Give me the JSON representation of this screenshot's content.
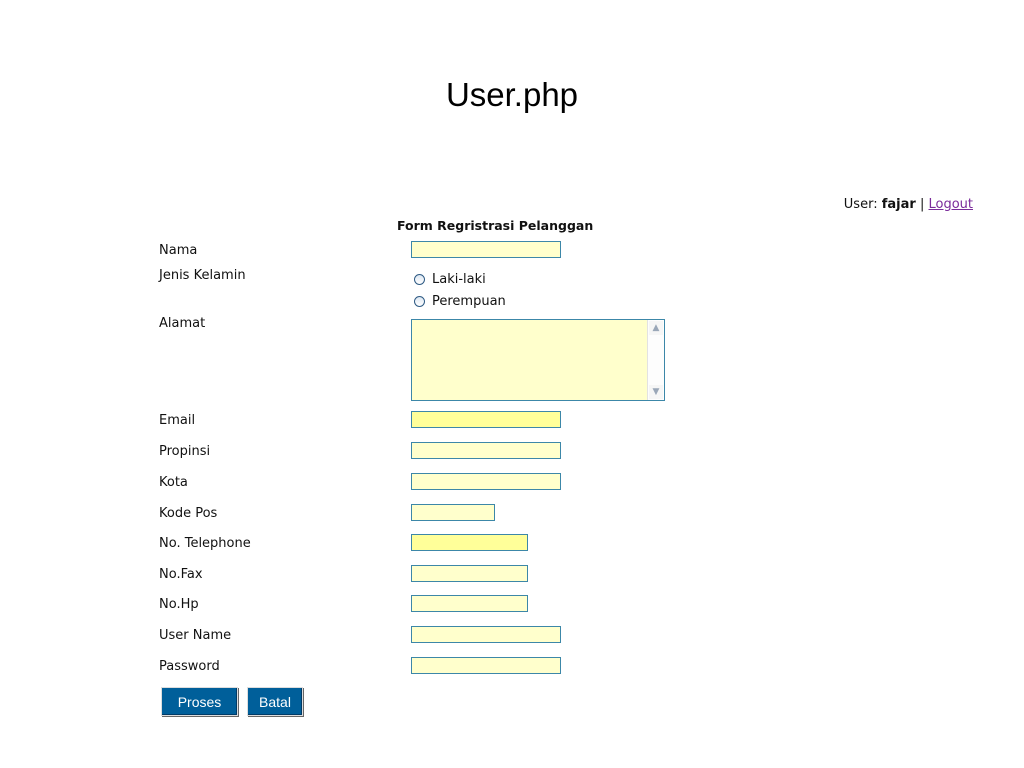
{
  "page_title": "User.php",
  "userbar": {
    "prefix": "User:",
    "username": "fajar",
    "separator": "|",
    "logout_label": "Logout"
  },
  "form": {
    "heading": "Form Regristrasi Pelanggan",
    "labels": {
      "nama": "Nama",
      "jenis_kelamin": "Jenis Kelamin",
      "alamat": "Alamat",
      "email": "Email",
      "propinsi": "Propinsi",
      "kota": "Kota",
      "kode_pos": "Kode Pos",
      "no_telephone": "No. Telephone",
      "no_fax": "No.Fax",
      "no_hp": "No.Hp",
      "user_name": "User Name",
      "password": "Password"
    },
    "values": {
      "nama": "",
      "alamat": "",
      "email": "",
      "propinsi": "",
      "kota": "",
      "kode_pos": "",
      "no_telephone": "",
      "no_fax": "",
      "no_hp": "",
      "user_name": "",
      "password": ""
    },
    "gender_options": [
      "Laki-laki",
      "Perempuan"
    ],
    "buttons": {
      "submit": "Proses",
      "cancel": "Batal"
    }
  },
  "colors": {
    "input_background": "#ffffcc",
    "input_background_highlight": "#ffff99",
    "input_border": "#3c87a8",
    "button_background": "#005f9a",
    "link": "#7a2a9a"
  }
}
